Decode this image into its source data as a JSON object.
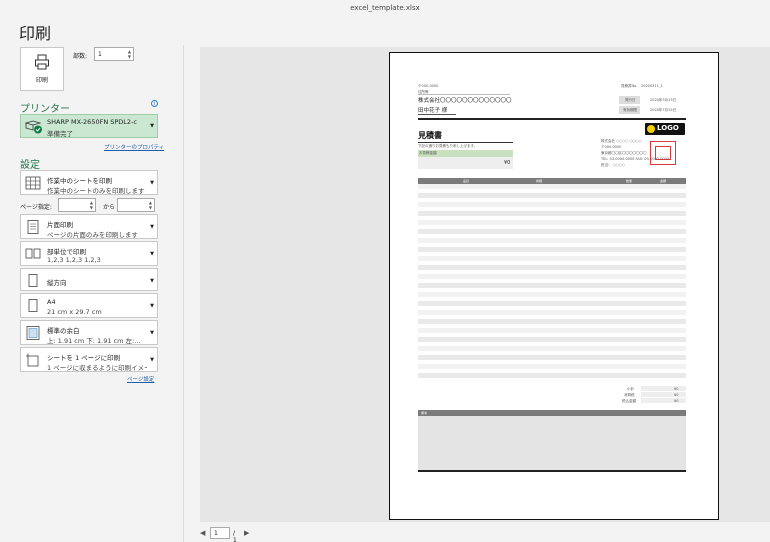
{
  "window": {
    "filename": "excel_template.xlsx",
    "title": "印刷"
  },
  "print": {
    "button_label": "印刷",
    "copies_label": "部数:",
    "copies_value": "1"
  },
  "printer": {
    "section_title": "プリンター",
    "name": "SHARP MX-2650FN SPDL2-c",
    "status": "準備完了",
    "properties_link": "プリンターのプロパティ"
  },
  "settings": {
    "section_title": "設定",
    "options": [
      {
        "title": "作業中のシートを印刷",
        "subtitle": "作業中のシートのみを印刷します"
      },
      {
        "title": "片面印刷",
        "subtitle": "ページの片面のみを印刷します"
      },
      {
        "title": "部単位で印刷",
        "subtitle": "1,2,3    1,2,3    1,2,3"
      },
      {
        "title": "縦方向",
        "subtitle": ""
      },
      {
        "title": "A4",
        "subtitle": "21 cm x 29.7 cm"
      },
      {
        "title": "標準の余白",
        "subtitle": "上: 1.91 cm 下: 1.91 cm 左:..."
      },
      {
        "title": "シートを 1 ページに印刷",
        "subtitle": "1 ページに収まるように印刷イメー..."
      }
    ],
    "pages_label": "ページ指定:",
    "pages_to": "から",
    "page_setup_link": "ページ設定"
  },
  "pager": {
    "current": "1",
    "total": "/ 1"
  },
  "document": {
    "postal": "〒000-0000",
    "address": "住所等",
    "company": "株式会社〇〇〇〇〇〇〇〇〇〇〇〇〇",
    "person": "田中花子 様",
    "doc_no_label": "見積書No.",
    "doc_no": "20200311_1",
    "issue_label": "発行日",
    "issue_date": "2020年3月15日",
    "valid_label": "有効期限",
    "valid_date": "2020年7月15日",
    "heading": "見積書",
    "intro": "下記の通りお見積もり申し上げます。",
    "total_label": "お見積金額",
    "total_value": "¥0",
    "logo": "LOGO",
    "issuer": [
      "株式会社 ○○○○ ○○○○",
      "〒000-0000",
      "東京都〇〇区〇〇〇〇〇〇〇",
      "TEL: 03-0000-0000 FAX: 03-0000-0000",
      "担当：  ○○○○"
    ],
    "columns": [
      "品目",
      "詳細",
      "数量",
      "金額"
    ],
    "subtotal_label": "小計",
    "tax_label": "消費税",
    "grand_label": "税込金額",
    "zero": "¥0",
    "notes_label": "備考"
  }
}
